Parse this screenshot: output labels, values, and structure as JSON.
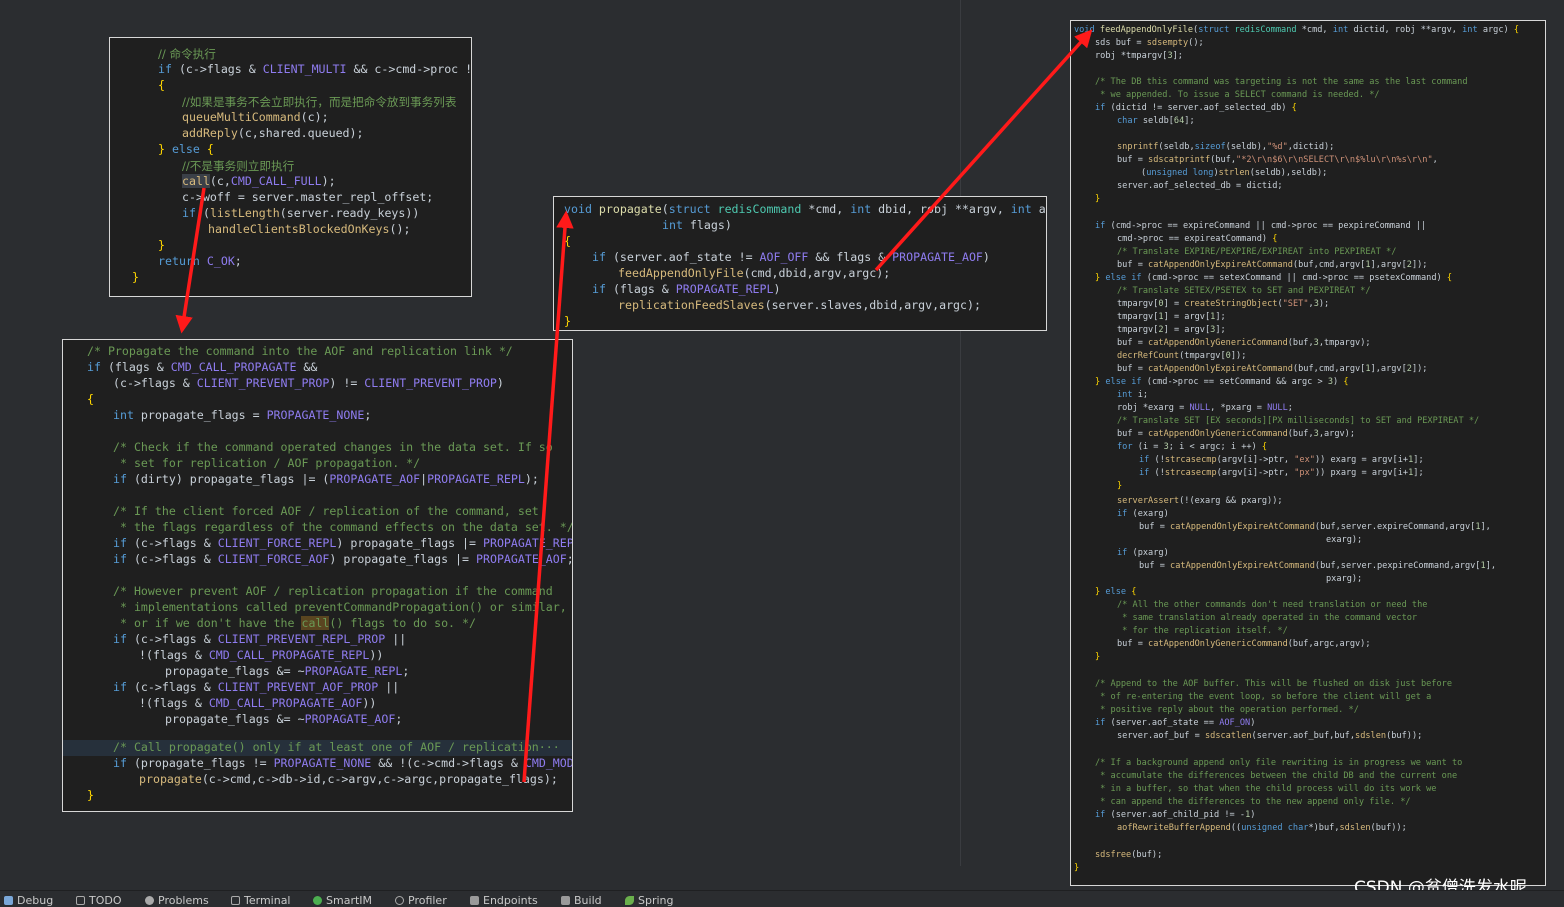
{
  "toolwindows": [
    {
      "label": "Debug",
      "icon": "bug-icon"
    },
    {
      "label": "TODO",
      "icon": "list-icon"
    },
    {
      "label": "Problems",
      "icon": "info-icon"
    },
    {
      "label": "Terminal",
      "icon": "terminal-icon"
    },
    {
      "label": "SmartIM",
      "icon": "chat-icon"
    },
    {
      "label": "Profiler",
      "icon": "profiler-icon"
    },
    {
      "label": "Endpoints",
      "icon": "endpoints-icon"
    },
    {
      "label": "Build",
      "icon": "hammer-icon"
    },
    {
      "label": "Spring",
      "icon": "leaf-icon"
    }
  ],
  "watermark": "CSDN @贫僧洗发水呢",
  "colors": {
    "arrow": "#ff1a1a",
    "background": "#2b2d30",
    "code_bg": "#1f1f1f"
  }
}
